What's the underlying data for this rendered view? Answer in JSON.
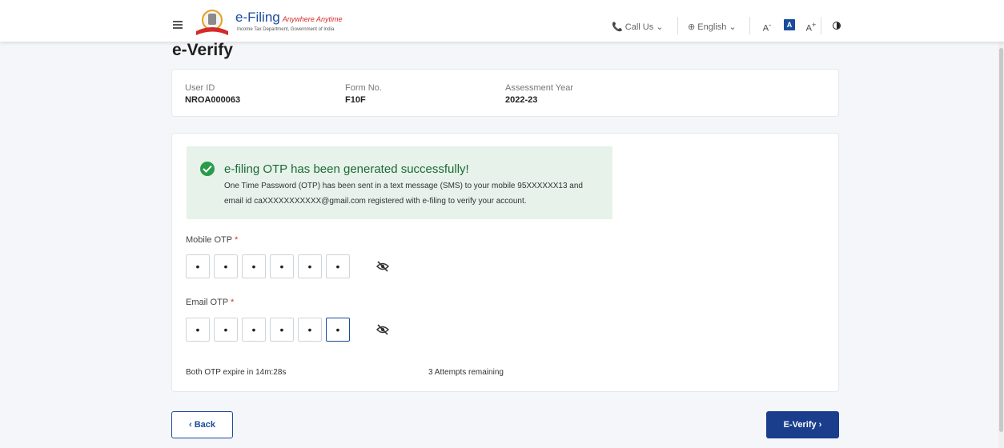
{
  "header": {
    "logo_title": "e-Filing",
    "logo_tagline": "Anywhere Anytime",
    "logo_subtitle": "Income Tax Department, Government of India",
    "call_us": "Call Us",
    "language": "English",
    "font_decrease": "A",
    "font_normal": "A",
    "font_increase": "A"
  },
  "page": {
    "title": "e-Verify"
  },
  "info": {
    "user_id_label": "User ID",
    "user_id_value": "NROA000063",
    "form_no_label": "Form No.",
    "form_no_value": "F10F",
    "ay_label": "Assessment Year",
    "ay_value": "2022-23"
  },
  "alert": {
    "title": "e-filing OTP has been generated successfully!",
    "message": "One Time Password (OTP) has been sent in a text message (SMS) to your mobile 95XXXXXX13 and email id caXXXXXXXXXXX@gmail.com registered with e-filing to verify your account."
  },
  "mobile_otp": {
    "label": "Mobile OTP",
    "required": "*",
    "digits": [
      "•",
      "•",
      "•",
      "•",
      "•",
      "•"
    ]
  },
  "email_otp": {
    "label": "Email OTP",
    "required": "*",
    "digits": [
      "•",
      "•",
      "•",
      "•",
      "•",
      "•"
    ]
  },
  "footer_info": {
    "expire": "Both OTP expire in 14m:28s",
    "attempts": "3 Attempts remaining"
  },
  "buttons": {
    "back": "‹ Back",
    "verify": "E-Verify ›"
  },
  "colors": {
    "brand_blue": "#1a4b9c",
    "success_green": "#2a9b4a",
    "alert_bg": "#e6f2ea"
  }
}
